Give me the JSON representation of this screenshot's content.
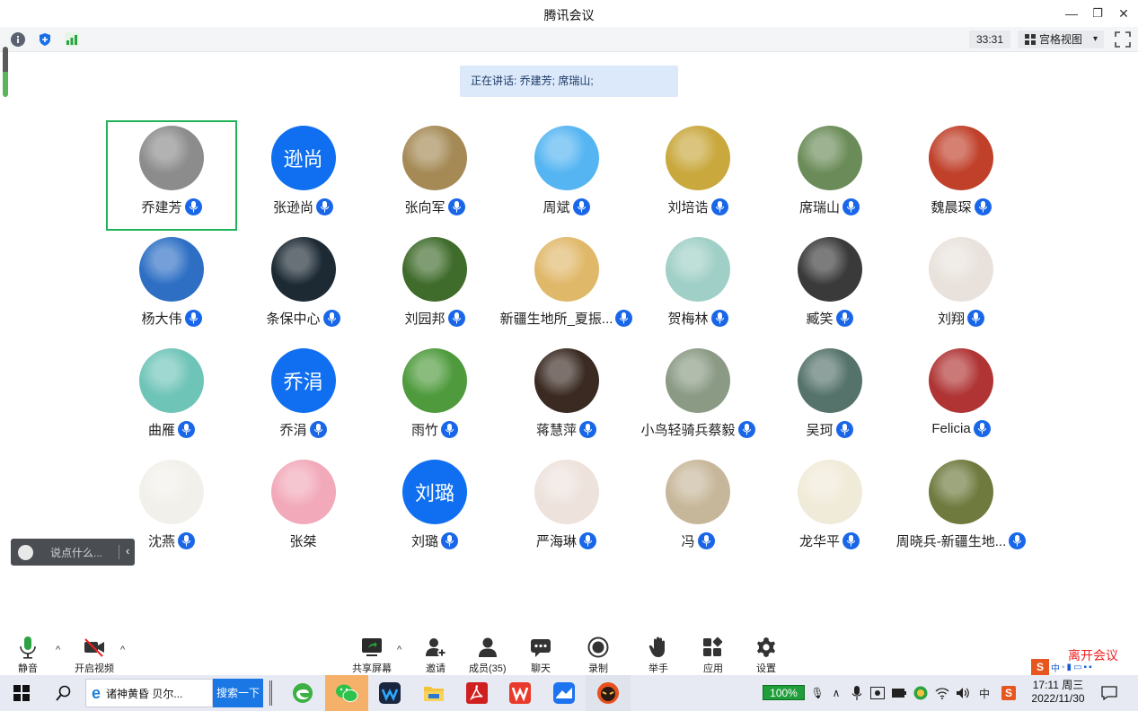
{
  "window": {
    "title": "腾讯会议",
    "minimize": "—",
    "restore": "❐",
    "close": "✕"
  },
  "toolbar": {
    "timer": "33:31",
    "view_label": "宫格视图",
    "view_caret": "▾"
  },
  "speaking": {
    "text": "正在讲话: 乔建芳; 席瑞山;"
  },
  "participants": [
    {
      "name": "乔建芳",
      "avatar_text": "",
      "color": "#8c8c8c",
      "active": true
    },
    {
      "name": "张逊尚",
      "avatar_text": "逊尚",
      "color": "#0f6ff0"
    },
    {
      "name": "张向军",
      "avatar_text": "",
      "color": "#a58a56"
    },
    {
      "name": "周斌",
      "avatar_text": "",
      "color": "#55b5f2"
    },
    {
      "name": "刘培诰",
      "avatar_text": "",
      "color": "#c9a83d"
    },
    {
      "name": "席瑞山",
      "avatar_text": "",
      "color": "#6b8c58"
    },
    {
      "name": "魏晨琛",
      "avatar_text": "",
      "color": "#c0402a"
    },
    {
      "name": "杨大伟",
      "avatar_text": "",
      "color": "#2e6fc4"
    },
    {
      "name": "条保中心",
      "avatar_text": "",
      "color": "#1d2a34"
    },
    {
      "name": "刘园邦",
      "avatar_text": "",
      "color": "#3f6b2b"
    },
    {
      "name": "新疆生地所_夏振...",
      "avatar_text": "",
      "color": "#e0b86a"
    },
    {
      "name": "贺梅林",
      "avatar_text": "",
      "color": "#9fcfc6"
    },
    {
      "name": "臧笑",
      "avatar_text": "",
      "color": "#3a3a3a"
    },
    {
      "name": "刘翔",
      "avatar_text": "",
      "color": "#e9e2dc"
    },
    {
      "name": "曲雁",
      "avatar_text": "",
      "color": "#6fc4b8"
    },
    {
      "name": "乔涓",
      "avatar_text": "乔涓",
      "color": "#0f6ff0"
    },
    {
      "name": "雨竹",
      "avatar_text": "",
      "color": "#4e9a3c"
    },
    {
      "name": "蒋慧萍",
      "avatar_text": "",
      "color": "#3a2a22"
    },
    {
      "name": "小鸟轻骑兵蔡毅",
      "avatar_text": "",
      "color": "#8a9a84"
    },
    {
      "name": "吴珂",
      "avatar_text": "",
      "color": "#55726b"
    },
    {
      "name": "Felicia",
      "avatar_text": "",
      "color": "#b03434"
    },
    {
      "name": "沈燕",
      "avatar_text": "",
      "color": "#f2f0ea"
    },
    {
      "name": "张桀",
      "avatar_text": "",
      "color": "#f2a9b9"
    },
    {
      "name": "刘璐",
      "avatar_text": "刘璐",
      "color": "#0f6ff0"
    },
    {
      "name": "严海琳",
      "avatar_text": "",
      "color": "#ede2dc"
    },
    {
      "name": "冯",
      "avatar_text": "",
      "color": "#c7b79a"
    },
    {
      "name": "龙华平",
      "avatar_text": "",
      "color": "#f0ead8"
    },
    {
      "name": "周晓兵-新疆生地...",
      "avatar_text": "",
      "color": "#6e7a3e"
    }
  ],
  "chat_quick": {
    "placeholder": "说点什么...",
    "collapse": "‹"
  },
  "controls": {
    "mute": "静音",
    "video": "开启视频",
    "share": "共享屏幕",
    "invite": "邀请",
    "members": "成员(35)",
    "chat": "聊天",
    "record": "录制",
    "raise_hand": "举手",
    "apps": "应用",
    "settings": "设置",
    "leave": "离开会议",
    "caret": "^"
  },
  "taskbar": {
    "search_text": "诸神黄昏 贝尔...",
    "search_button": "搜索一下",
    "battery": "100%",
    "time": "17:11 周三",
    "date": "2022/11/30",
    "ime": "中",
    "ime_strip": "中"
  }
}
